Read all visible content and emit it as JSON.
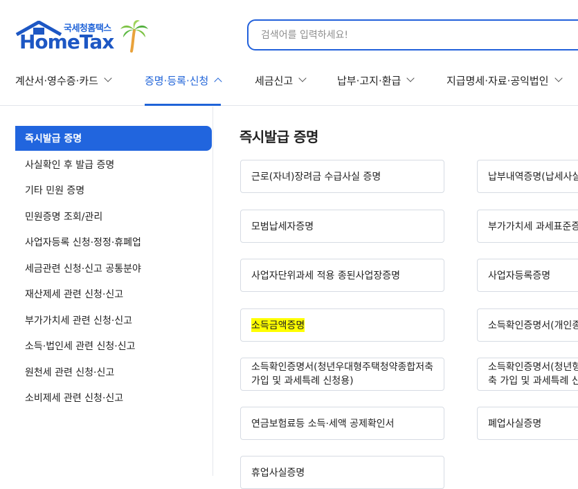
{
  "header": {
    "logo_sub": "국세청홈택스",
    "logo_main": "HomeTax",
    "search_placeholder": "검색어를 입력하세요!"
  },
  "topnav": {
    "items": [
      {
        "label": "계산서·영수증·카드",
        "active": false
      },
      {
        "label": "증명·등록·신청",
        "active": true
      },
      {
        "label": "세금신고",
        "active": false
      },
      {
        "label": "납부·고지·환급",
        "active": false
      },
      {
        "label": "지급명세·자료·공익법인",
        "active": false
      }
    ]
  },
  "sidebar": {
    "items": [
      {
        "label": "즉시발급 증명",
        "active": true
      },
      {
        "label": "사실확인 후 발급 증명",
        "active": false
      },
      {
        "label": "기타 민원 증명",
        "active": false
      },
      {
        "label": "민원증명 조회/관리",
        "active": false
      },
      {
        "label": "사업자등록 신청·정정·휴폐업",
        "active": false
      },
      {
        "label": "세금관련 신청·신고 공통분야",
        "active": false
      },
      {
        "label": "재산제세 관련 신청·신고",
        "active": false
      },
      {
        "label": "부가가치세 관련 신청·신고",
        "active": false
      },
      {
        "label": "소득·법인세 관련 신청·신고",
        "active": false
      },
      {
        "label": "원천세 관련 신청·신고",
        "active": false
      },
      {
        "label": "소비제세 관련 신청·신고",
        "active": false
      }
    ]
  },
  "main": {
    "title": "즉시발급 증명",
    "cards_left": [
      {
        "label": "근로(자녀)장려금 수급사실 증명"
      },
      {
        "label": "모범납세자증명"
      },
      {
        "label": "사업자단위과세 적용 종된사업장증명"
      },
      {
        "label": "소득금액증명",
        "highlight": true
      },
      {
        "label": "소득확인증명서(청년우대형주택청약종합저축 가입 및 과세특례 신청용)"
      },
      {
        "label": "연금보험료등 소득·세액 공제확인서"
      },
      {
        "label": "휴업사실증명"
      }
    ],
    "cards_right": [
      {
        "label": "납부내역증명(납세사실"
      },
      {
        "label": "부가가치세 과세표준증"
      },
      {
        "label": "사업자등록증명"
      },
      {
        "label": "소득확인증명서(개인종"
      },
      {
        "label": "소득확인증명서(청년형\n축 가입 및 과세특례 신"
      },
      {
        "label": "폐업사실증명"
      }
    ]
  }
}
